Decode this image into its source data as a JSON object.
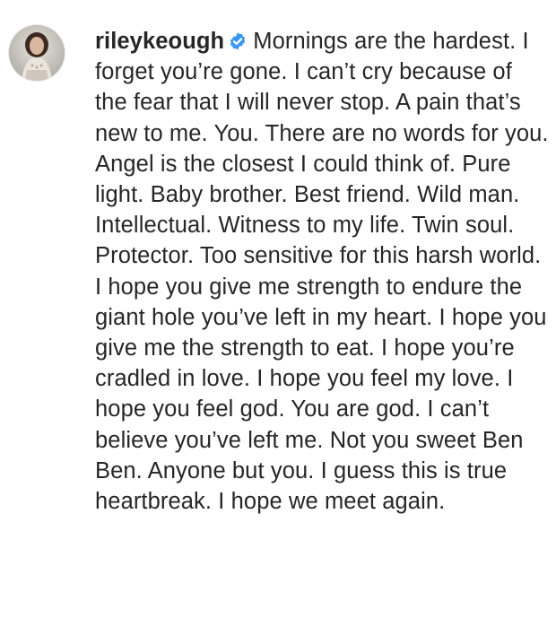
{
  "comment": {
    "username": "rileykeough",
    "verified": true,
    "verified_icon": "verified-badge-icon",
    "avatar_icon": "profile-avatar",
    "text": "Mornings are the hardest. I forget you’re gone. I can’t cry because of the fear that I will never stop. A pain that’s new to me. You. There are no words for you. Angel is the closest I could think of. Pure light. Baby brother. Best friend. Wild man. Intellectual. Witness to my life. Twin soul. Protector. Too sensitive for this harsh world. I hope you give me strength to endure the giant hole you’ve left in my heart. I hope you give me the strength to eat. I hope you’re cradled in love. I hope you feel my love. I hope you feel god. You are god. I can’t believe you’ve left me. Not you sweet Ben Ben. Anyone but you. I guess this is true heartbreak. I hope we meet again."
  },
  "colors": {
    "text": "#262626",
    "verified_badge": "#3897f0",
    "background": "#ffffff"
  }
}
